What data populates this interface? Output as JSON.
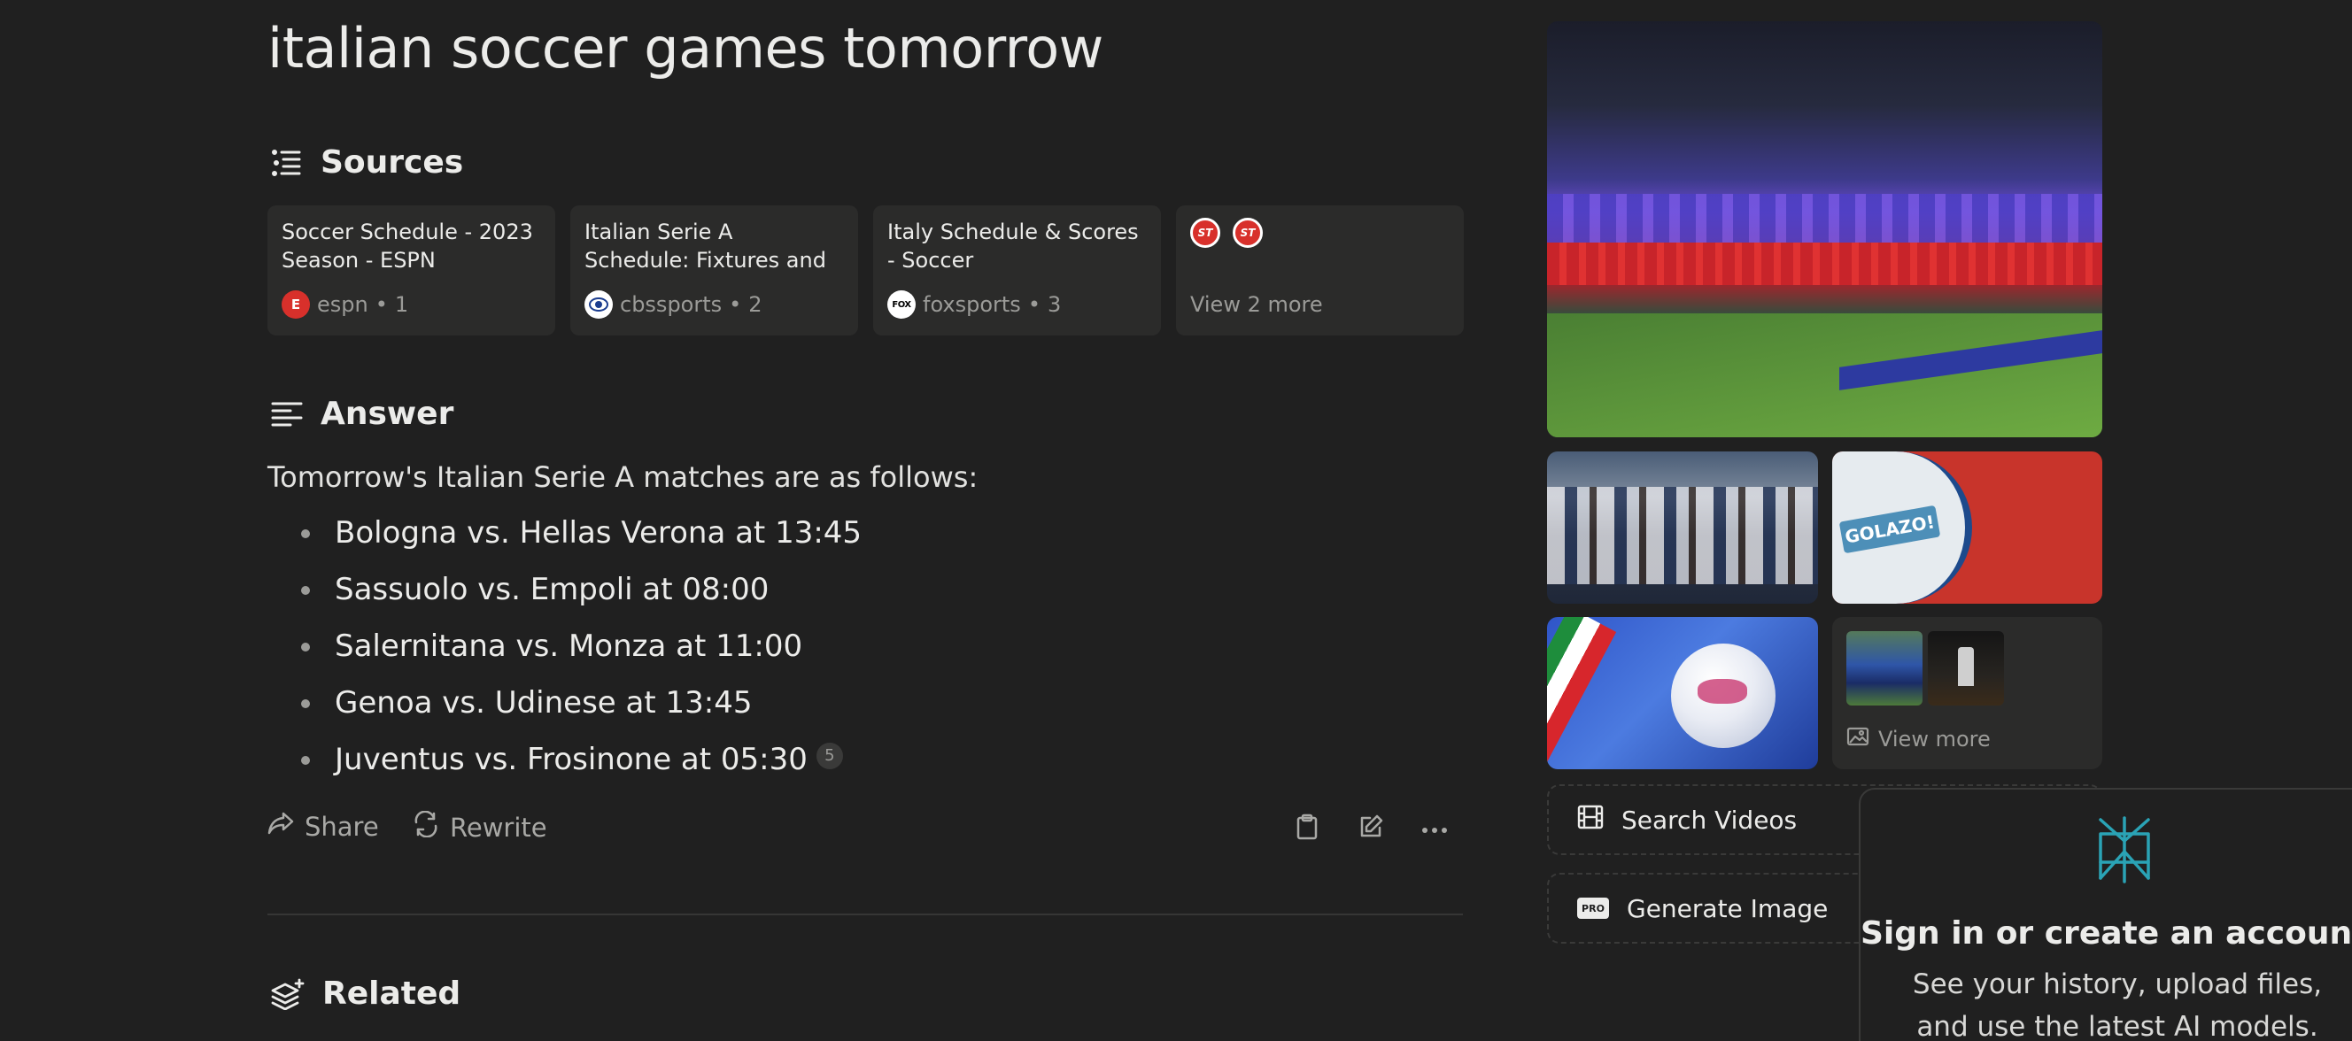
{
  "query": "italian soccer games tomorrow",
  "sources": {
    "heading": "Sources",
    "cards": [
      {
        "title": "Soccer Schedule - 2023 Season - ESPN",
        "site": "espn",
        "index": "1"
      },
      {
        "title": "Italian Serie A Schedule: Fixtures and results",
        "site": "cbssports",
        "index": "2"
      },
      {
        "title": "Italy Schedule & Scores - Soccer",
        "site": "foxsports",
        "index": "3"
      }
    ],
    "view_more": "View 2 more"
  },
  "answer": {
    "heading": "Answer",
    "intro": "Tomorrow's Italian Serie A matches are as follows:",
    "items": [
      "Bologna vs. Hellas Verona at 13:45",
      "Sassuolo vs. Empoli at 08:00",
      "Salernitana vs. Monza at 11:00",
      "Genoa vs. Udinese at 13:45",
      "Juventus vs. Frosinone at 05:30"
    ],
    "citation": "5"
  },
  "actions": {
    "share": "Share",
    "rewrite": "Rewrite"
  },
  "related": {
    "heading": "Related"
  },
  "media": {
    "view_more": "View more",
    "golazo_text": "GOLAZO!",
    "search_videos": "Search Videos",
    "generate_image": "Generate Image",
    "pro_badge": "PRO"
  },
  "signin": {
    "title": "Sign in or create an account",
    "subtitle": "See your history, upload files, and use the latest AI models."
  },
  "logos": {
    "espn": "E",
    "cbs": "CBS",
    "fox": "FOX",
    "st": "ST"
  }
}
